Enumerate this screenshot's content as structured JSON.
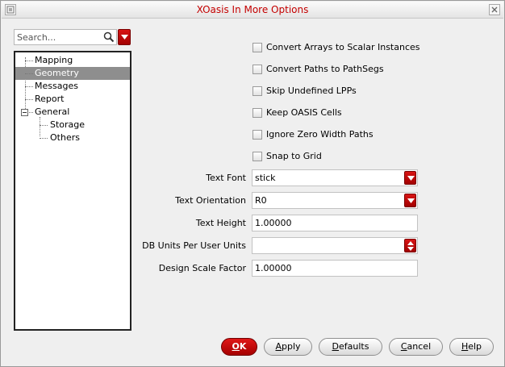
{
  "window": {
    "title": "XOasis In More Options"
  },
  "search": {
    "placeholder": "Search..."
  },
  "tree": {
    "items": [
      {
        "label": "Mapping"
      },
      {
        "label": "Geometry"
      },
      {
        "label": "Messages"
      },
      {
        "label": "Report"
      },
      {
        "label": "General"
      },
      {
        "label": "Storage"
      },
      {
        "label": "Others"
      }
    ],
    "selected": "Geometry"
  },
  "options": [
    {
      "label": "Convert Arrays to Scalar Instances",
      "checked": false
    },
    {
      "label": "Convert Paths to PathSegs",
      "checked": false
    },
    {
      "label": "Skip Undefined LPPs",
      "checked": false
    },
    {
      "label": "Keep OASIS Cells",
      "checked": false
    },
    {
      "label": "Ignore Zero Width Paths",
      "checked": false
    },
    {
      "label": "Snap to Grid",
      "checked": false
    }
  ],
  "form": {
    "text_font": {
      "label": "Text Font",
      "value": "stick"
    },
    "text_orientation": {
      "label": "Text Orientation",
      "value": "R0"
    },
    "text_height": {
      "label": "Text Height",
      "value": "1.00000"
    },
    "db_units": {
      "label": "DB Units Per User Units",
      "value": ""
    },
    "design_scale": {
      "label": "Design Scale Factor",
      "value": "1.00000"
    }
  },
  "buttons": {
    "ok": {
      "mnemonic": "O",
      "rest": "K"
    },
    "apply": {
      "mnemonic": "A",
      "rest": "pply"
    },
    "defaults": {
      "mnemonic": "D",
      "rest": "efaults"
    },
    "cancel": {
      "mnemonic": "C",
      "rest": "ancel"
    },
    "help": {
      "mnemonic": "H",
      "rest": "elp"
    }
  },
  "colors": {
    "title": "#c40000",
    "accent": "#c40000",
    "selection": "#8e8e8e"
  }
}
